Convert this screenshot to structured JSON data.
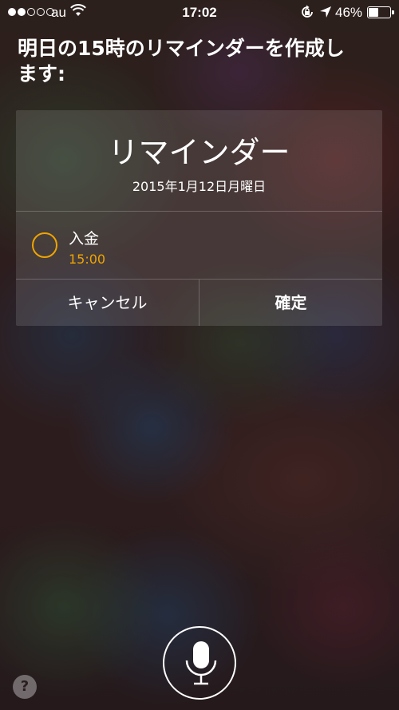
{
  "status_bar": {
    "carrier": "au",
    "time": "17:02",
    "battery_percent": "46%",
    "battery_level": 0.46,
    "signal_bars_filled": 2,
    "signal_bars_total": 5
  },
  "siri": {
    "prompt": "明日の15時のリマインダーを作成します:"
  },
  "reminder_card": {
    "title": "リマインダー",
    "date": "2015年1月12日月曜日",
    "task_title": "入金",
    "task_time": "15:00",
    "cancel_label": "キャンセル",
    "confirm_label": "確定"
  },
  "help_label": "?",
  "icons": {
    "wifi": "wifi-icon",
    "rotation_lock": "rotation-lock-icon",
    "location": "location-arrow-icon",
    "battery": "battery-icon",
    "microphone": "microphone-icon",
    "reminder_check": "reminder-circle-icon"
  },
  "colors": {
    "accent": "#f0a400"
  }
}
